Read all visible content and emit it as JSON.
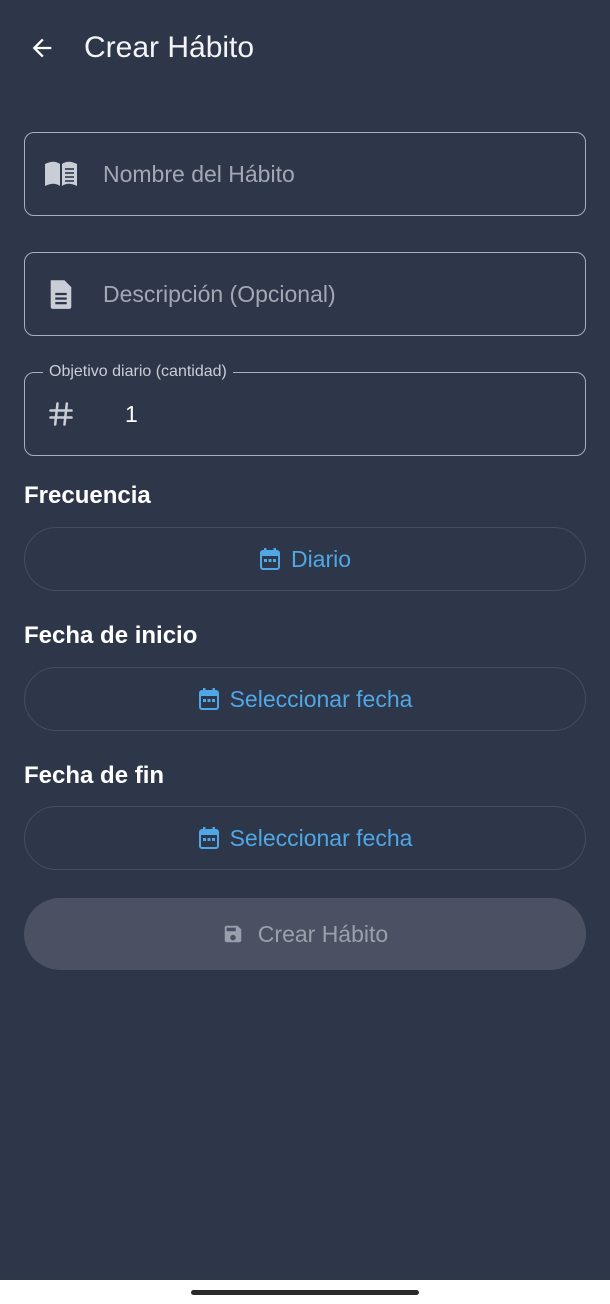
{
  "appbar": {
    "title": "Crear Hábito",
    "back_icon": "arrow-left-icon"
  },
  "form": {
    "name_field": {
      "placeholder": "Nombre del Hábito",
      "value": "",
      "icon": "book-icon"
    },
    "description_field": {
      "placeholder": "Descripción (Opcional)",
      "value": "",
      "icon": "document-icon"
    },
    "goal_field": {
      "label": "Objetivo diario (cantidad)",
      "value": "1",
      "icon": "hash-icon"
    },
    "frequency": {
      "label": "Frecuencia",
      "button_label": "Diario",
      "icon": "calendar-icon"
    },
    "start_date": {
      "label": "Fecha de inicio",
      "button_label": "Seleccionar fecha",
      "icon": "calendar-icon"
    },
    "end_date": {
      "label": "Fecha de fin",
      "button_label": "Seleccionar fecha",
      "icon": "calendar-icon"
    },
    "submit": {
      "label": "Crear Hábito",
      "icon": "save-icon",
      "enabled": false
    }
  },
  "colors": {
    "background": "#2e3649",
    "accent": "#4fa7e6",
    "disabled_button": "#4a5162",
    "field_border": "#a9afbb"
  }
}
